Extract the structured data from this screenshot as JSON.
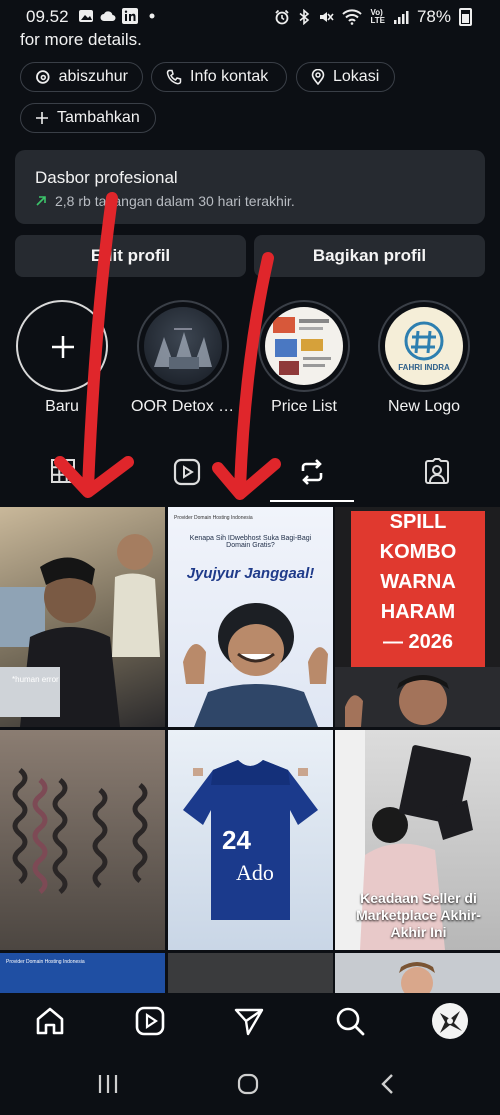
{
  "status": {
    "time": "09.52",
    "left_icons": [
      "image-icon",
      "cloud-icon",
      "linkedin-icon",
      "dot-icon"
    ],
    "right_icons": [
      "alarm-icon",
      "bluetooth-icon",
      "mute-icon",
      "wifi-icon",
      "volte-icon",
      "signal-icon"
    ],
    "volte": "Vo)\nLTE",
    "battery": "78%"
  },
  "bio": {
    "text": "for more details."
  },
  "chips": {
    "threads": {
      "label": "abiszuhur",
      "icon": "threads-icon"
    },
    "contact": {
      "label": "Info kontak",
      "icon": "phone-icon"
    },
    "location": {
      "label": "Lokasi",
      "icon": "location-pin-icon"
    },
    "add": {
      "label": "Tambahkan",
      "icon": "plus-icon"
    }
  },
  "dashboard": {
    "title": "Dasbor profesional",
    "subtitle": "2,8 rb tayangan dalam 30 hari terakhir.",
    "trend_color": "#3cc46a"
  },
  "buttons": {
    "edit": "Edit profil",
    "share": "Bagikan profil"
  },
  "highlights": [
    {
      "label": "Baru",
      "icon": "plus-icon"
    },
    {
      "label": "OOR Detox JK..."
    },
    {
      "label": "Price List"
    },
    {
      "label": "New Logo",
      "logo_text": "FAHRI INDRA"
    }
  ],
  "profile_tabs": [
    {
      "name": "grid",
      "icon": "grid-icon"
    },
    {
      "name": "reels",
      "icon": "reels-icon"
    },
    {
      "name": "reposts",
      "icon": "repost-icon",
      "active": true
    },
    {
      "name": "tagged",
      "icon": "tagged-person-icon"
    }
  ],
  "posts": [
    {
      "caption": "*human error"
    },
    {
      "header": "Provider Domain Hosting Indonesia",
      "question": "Kenapa Sih IDwebhost Suka Bagi-Bagi Domain Gratis?",
      "headline": "Jyujyur Janggaal!"
    },
    {
      "lines": [
        "SPILL",
        "KOMBO",
        "WARNA",
        "HARAM",
        "— 2026"
      ]
    },
    {
      "jersey_number": "24",
      "jersey_text": "Ado"
    },
    {
      "caption": "Keadaan Seller di Marketplace Akhir-Akhir Ini"
    },
    {
      "header": "Provider Domain Hosting Indonesia"
    }
  ],
  "bottom_nav": [
    "home-icon",
    "reels-icon",
    "send-icon",
    "search-icon",
    "profile-avatar"
  ],
  "system_nav": [
    "recents-icon",
    "home-circle-icon",
    "back-icon"
  ],
  "colors": {
    "background": "#0c0f14",
    "card": "#262a30",
    "annotation_arrow": "#e0262b"
  }
}
